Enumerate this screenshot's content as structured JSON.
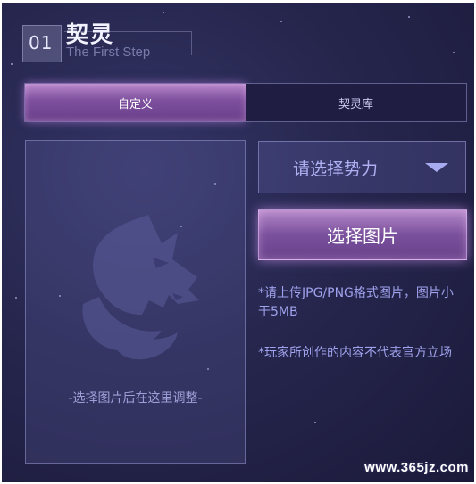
{
  "header": {
    "step_number": "01",
    "title": "契灵",
    "subtitle": "The First Step"
  },
  "tabs": [
    {
      "label": "自定义",
      "active": true
    },
    {
      "label": "契灵库",
      "active": false
    }
  ],
  "preview": {
    "hint": "-选择图片后在这里调整-",
    "icon": "wolf-head-logo"
  },
  "faction_select": {
    "value": "请选择势力",
    "icon": "chevron-down-icon"
  },
  "choose_image_button": "选择图片",
  "notes": [
    "*请上传JPG/PNG格式图片，图片小于5MB",
    "*玩家所创作的内容不代表官方立场"
  ],
  "watermark": "www.365jz.com",
  "colors": {
    "background": "#26264e",
    "accent": "#7d4f9d",
    "text_light": "#9fa2ec"
  }
}
